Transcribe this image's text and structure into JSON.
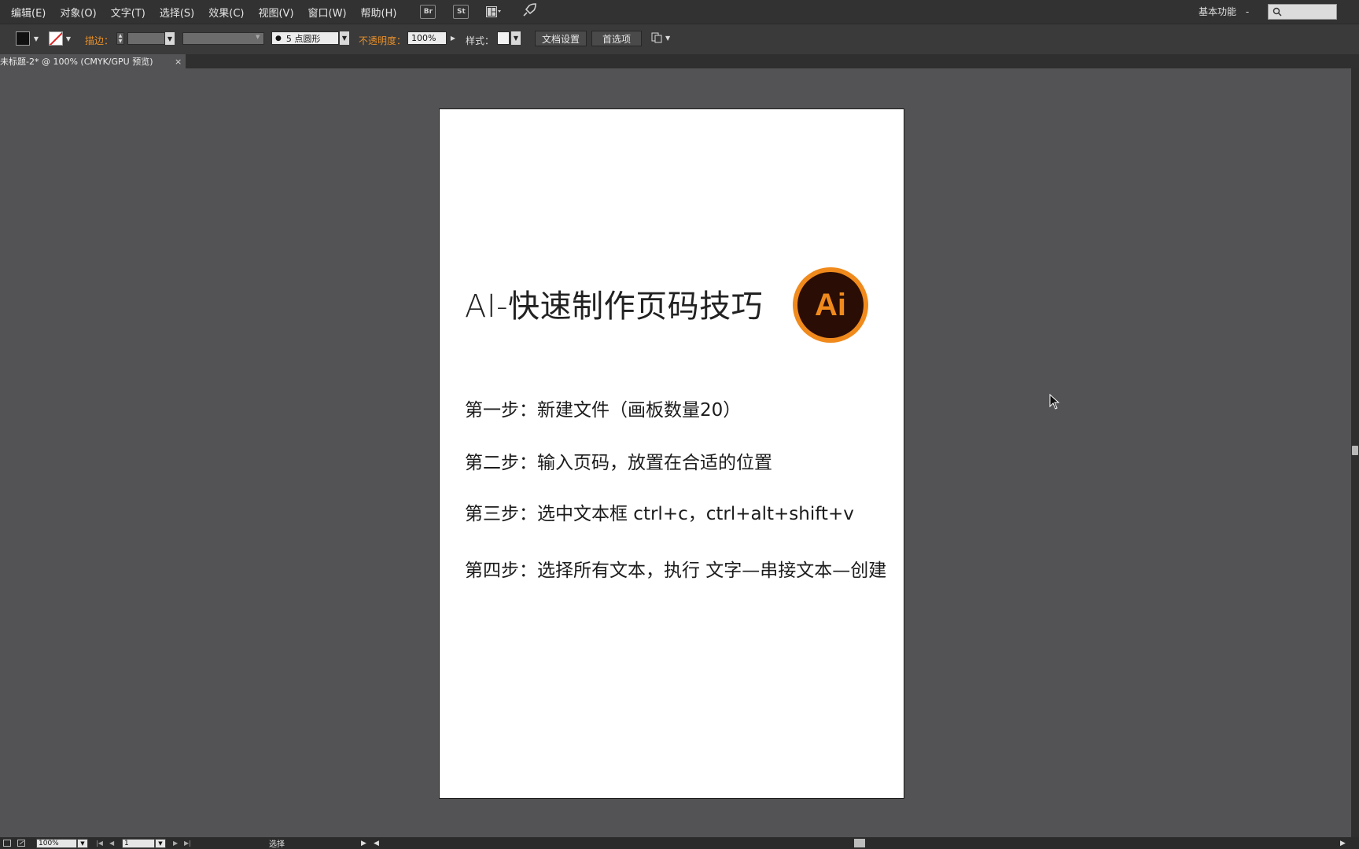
{
  "menubar": {
    "items": [
      "编辑(E)",
      "对象(O)",
      "文字(T)",
      "选择(S)",
      "效果(C)",
      "视图(V)",
      "窗口(W)",
      "帮助(H)"
    ],
    "app_icons": [
      "Br",
      "St"
    ],
    "layout_icon": "arrange-documents-icon",
    "gpu_icon": "rocket-icon",
    "workspace": "基本功能",
    "workspace_caret": "-",
    "search_placeholder": ""
  },
  "controlbar": {
    "stroke_label": "描边：",
    "stroke_value": "",
    "brush_dot": "●",
    "brush_value": "5 点圆形",
    "opacity_label": "不透明度：",
    "opacity_value": "100%",
    "style_label": "样式：",
    "doc_setup_button": "文档设置",
    "preferences_button": "首选项",
    "extra_icon": "doc-arrange-icon"
  },
  "tab": {
    "title": "未标题-2* @ 100% (CMYK/GPU 预览)",
    "close": "×"
  },
  "artboard": {
    "title": "AI-快速制作页码技巧",
    "logo_text": "Ai",
    "steps": [
      "第一步：新建文件（画板数量20）",
      "第二步：输入页码，放置在合适的位置",
      "第三步：选中文本框 ctrl+c，ctrl+alt+shift+v",
      "第四步：选择所有文本，执行 文字—串接文本—创建"
    ]
  },
  "colors": {
    "logo_ring": "#f08a1c",
    "logo_bg": "#2a0e05",
    "logo_text": "#f08a1c",
    "label_orange": "#e8902a"
  },
  "statusbar": {
    "zoom": "100%",
    "page": "1",
    "tool": "选择",
    "nav_first": "|◀",
    "nav_prev": "◀",
    "nav_next": "▶",
    "nav_last": "▶|"
  }
}
